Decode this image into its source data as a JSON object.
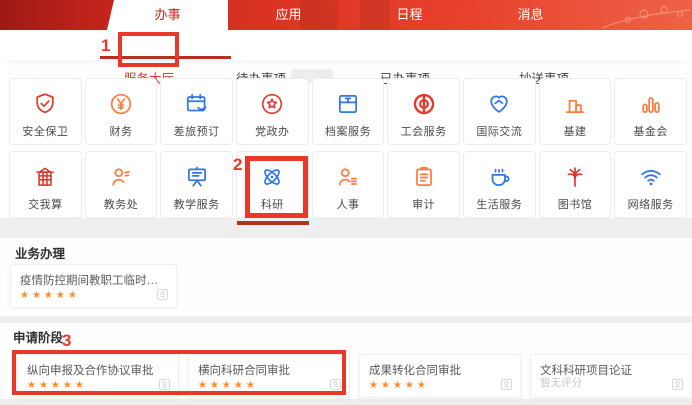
{
  "header": {
    "tabs": [
      {
        "label": "办事",
        "active": true
      },
      {
        "label": "应用",
        "active": false
      },
      {
        "label": "日程",
        "active": false
      },
      {
        "label": "消息",
        "active": false
      }
    ]
  },
  "subnav": {
    "items": [
      {
        "label": "服务大厅",
        "active": true
      },
      {
        "label": "待办事项",
        "redacted_badge": true
      },
      {
        "label": "已办事项",
        "active": false
      },
      {
        "label": "抄送事项",
        "active": false
      }
    ]
  },
  "annotations": {
    "step1": "1",
    "step2": "2",
    "step3": "3"
  },
  "apps": {
    "row1": [
      {
        "label": "安全保卫",
        "icon": "shield-check-icon",
        "color": "#e5392e"
      },
      {
        "label": "财务",
        "icon": "yen-circle-icon",
        "color": "#ff7b3d"
      },
      {
        "label": "差旅预订",
        "icon": "travel-calendar-icon",
        "color": "#2e77e6"
      },
      {
        "label": "党政办",
        "icon": "star-circle-icon",
        "color": "#e5392e"
      },
      {
        "label": "档案服务",
        "icon": "archive-box-icon",
        "color": "#2e77e6"
      },
      {
        "label": "工会服务",
        "icon": "union-emblem-icon",
        "color": "#e5392e"
      },
      {
        "label": "国际交流",
        "icon": "heart-handshake-icon",
        "color": "#2e77e6"
      },
      {
        "label": "基建",
        "icon": "buildings-icon",
        "color": "#ff7b3d"
      },
      {
        "label": "基金会",
        "icon": "bar-chart-icon",
        "color": "#ff7b3d"
      }
    ],
    "row2": [
      {
        "label": "交我算",
        "icon": "computing-gate-icon",
        "color": "#d6342a"
      },
      {
        "label": "教务处",
        "icon": "person-edit-icon",
        "color": "#ff7b3d"
      },
      {
        "label": "教学服务",
        "icon": "presentation-board-icon",
        "color": "#2e77e6"
      },
      {
        "label": "科研",
        "icon": "atom-icon",
        "color": "#2e77e6",
        "highlighted": true
      },
      {
        "label": "人事",
        "icon": "person-list-icon",
        "color": "#ff7b3d"
      },
      {
        "label": "审计",
        "icon": "clipboard-icon",
        "color": "#ff7b3d"
      },
      {
        "label": "生活服务",
        "icon": "coffee-cup-icon",
        "color": "#2e77e6"
      },
      {
        "label": "图书馆",
        "icon": "library-tree-icon",
        "color": "#d6342a"
      },
      {
        "label": "网络服务",
        "icon": "wifi-icon",
        "color": "#2e77e6"
      }
    ]
  },
  "business_section": {
    "title": "业务办理",
    "card": {
      "title": "疫情防控期间教职工临时使用实验…",
      "stars": "★★★★★"
    }
  },
  "apply_section": {
    "title": "申请阶段",
    "cards": [
      {
        "title": "纵向申报及合作协议审批",
        "stars": "★★★★★"
      },
      {
        "title": "横向科研合同审批",
        "stars": "★★★★★"
      },
      {
        "title": "成果转化合同审批",
        "stars": "★★★★★"
      },
      {
        "title": "文科科研项目论证",
        "no_rating": "暂无评分"
      }
    ]
  },
  "colors": {
    "annotation_red": "#e8382a",
    "underline_red": "#b5321f",
    "icon_red": "#e5392e",
    "icon_orange": "#ff7b3d",
    "icon_blue": "#2e77e6",
    "star_orange": "#ff8a2b",
    "active_tab_text": "#c1281f",
    "subnav_active_text": "#d23a2c"
  }
}
